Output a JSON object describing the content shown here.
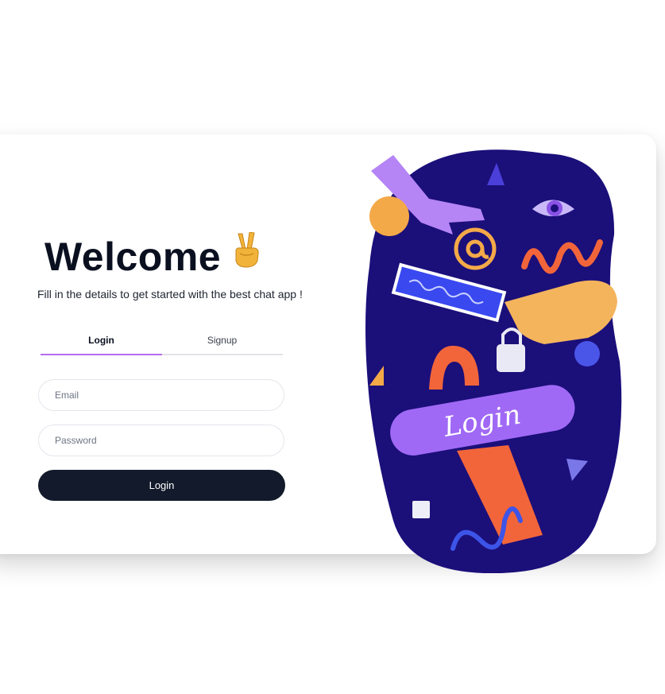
{
  "welcome": {
    "title": "Welcome",
    "emoji_icon": "victory-hand-icon",
    "subtitle": "Fill in the details to get started with the best chat app !"
  },
  "tabs": [
    {
      "label": "Login",
      "active": true
    },
    {
      "label": "Signup",
      "active": false
    }
  ],
  "form": {
    "email_placeholder": "Email",
    "password_placeholder": "Password",
    "login_button": "Login"
  },
  "illustration": {
    "sign_text": "Login",
    "icons": [
      "hand-icon",
      "at-sign-icon",
      "eye-icon",
      "padlock-icon",
      "password-bar-icon"
    ]
  },
  "colors": {
    "accent": "#b26df0",
    "button": "#121a2b",
    "blob": "#1b0f7a"
  }
}
